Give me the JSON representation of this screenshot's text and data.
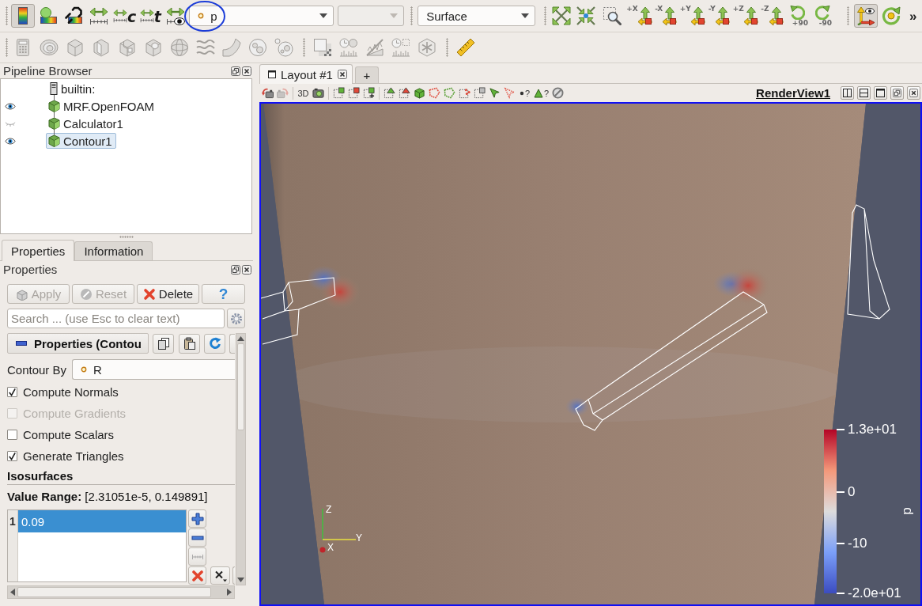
{
  "main_toolbar": {
    "color_buttons": [
      {
        "kind": "color-map",
        "on": true
      },
      {
        "kind": "sphere-bar",
        "on": false
      },
      {
        "kind": "unlink",
        "on": false
      },
      {
        "kind": "rescale",
        "on": false
      },
      {
        "kind": "rescale",
        "label": "c",
        "on": false
      },
      {
        "kind": "rescale",
        "label": "t",
        "on": false
      },
      {
        "kind": "rescale-visible",
        "on": false
      }
    ],
    "array_select": {
      "value": "p",
      "highlighted": true
    },
    "component_select": {
      "disabled": true
    },
    "representation_select": {
      "value": "Surface"
    },
    "camera_buttons": [
      {
        "kind": "reset"
      },
      {
        "kind": "zoom-data"
      },
      {
        "kind": "zoom-box"
      },
      {
        "kind": "axis",
        "label": "+X"
      },
      {
        "kind": "axis",
        "label": "-X"
      },
      {
        "kind": "axis",
        "label": "+Y"
      },
      {
        "kind": "axis",
        "label": "-Y"
      },
      {
        "kind": "axis",
        "label": "+Z"
      },
      {
        "kind": "axis",
        "label": "-Z"
      },
      {
        "kind": "rotate-cw",
        "label": "+90"
      },
      {
        "kind": "rotate-ccw",
        "label": "-90"
      }
    ],
    "view_buttons": [
      {
        "kind": "orientation-axes",
        "on": true
      },
      {
        "kind": "center-axes",
        "on": false
      }
    ],
    "overflow": "»"
  },
  "filters_toolbar": {
    "common": [
      {
        "kind": "calculator"
      },
      {
        "kind": "contour"
      },
      {
        "kind": "clip"
      },
      {
        "kind": "slice"
      },
      {
        "kind": "threshold"
      },
      {
        "kind": "subset"
      },
      {
        "kind": "glyph"
      },
      {
        "kind": "stream"
      },
      {
        "kind": "warp"
      },
      {
        "kind": "group"
      },
      {
        "kind": "level"
      }
    ],
    "analysis": [
      {
        "kind": "square-checker"
      },
      {
        "kind": "clock-bars"
      },
      {
        "kind": "plot-line"
      },
      {
        "kind": "clock-chart"
      },
      {
        "kind": "star-hex"
      }
    ],
    "measure": [
      {
        "kind": "ruler"
      }
    ]
  },
  "pipeline_browser": {
    "title": "Pipeline Browser",
    "server": "builtin:",
    "sources": [
      {
        "label": "MRF.OpenFOAM",
        "visible": true,
        "selected": false
      },
      {
        "label": "Calculator1",
        "visible": false,
        "selected": false
      },
      {
        "label": "Contour1",
        "visible": true,
        "selected": true
      }
    ]
  },
  "panel_tabs": [
    {
      "label": "Properties",
      "selected": true
    },
    {
      "label": "Information",
      "selected": false
    }
  ],
  "properties": {
    "title": "Properties",
    "buttons": [
      {
        "kind": "apply",
        "label": "Apply",
        "disabled": true
      },
      {
        "kind": "reset",
        "label": "Reset",
        "disabled": true
      },
      {
        "kind": "delete",
        "label": "Delete",
        "disabled": false
      },
      {
        "kind": "help",
        "label": "?",
        "disabled": false
      }
    ],
    "search": {
      "placeholder": "Search ... (use Esc to clear text)"
    },
    "section": {
      "title": "Properties (Contou",
      "expanded": true
    },
    "contour_by": {
      "label": "Contour By",
      "value": "R"
    },
    "options": [
      {
        "label": "Compute Normals",
        "checked": true,
        "disabled": false
      },
      {
        "label": "Compute Gradients",
        "checked": false,
        "disabled": true
      },
      {
        "label": "Compute Scalars",
        "checked": false,
        "disabled": false
      },
      {
        "label": "Generate Triangles",
        "checked": true,
        "disabled": false
      }
    ],
    "isosurfaces": {
      "title": "Isosurfaces",
      "value_range": "**Value Range:** [2.31051e-5, 0.149891]",
      "rows": [
        {
          "index": "1",
          "value": "0.09",
          "selected": true
        }
      ]
    }
  },
  "layout_tabs": [
    {
      "label": "Layout #1",
      "selected": true
    }
  ],
  "new_layout_tab": "+",
  "view_toolbar": {
    "groups": [
      {
        "buttons": [
          {
            "kind": "camera-undo",
            "disabled": false
          },
          {
            "kind": "camera-redo",
            "disabled": true
          }
        ]
      },
      {
        "buttons": [
          {
            "kind": "projection",
            "label": "3D",
            "disabled": false
          },
          {
            "kind": "capture",
            "disabled": false
          }
        ]
      },
      {
        "buttons": [
          {
            "kind": "sel-green",
            "disabled": false
          },
          {
            "kind": "sel-red",
            "disabled": false
          },
          {
            "kind": "sel-green-plus",
            "disabled": false
          }
        ]
      },
      {
        "buttons": [
          {
            "kind": "frustum-green",
            "disabled": false
          },
          {
            "kind": "frustum-red",
            "disabled": false
          },
          {
            "kind": "block",
            "disabled": false
          },
          {
            "kind": "poly-red",
            "disabled": false
          },
          {
            "kind": "poly-green",
            "disabled": false
          },
          {
            "kind": "sel-red-dots",
            "disabled": false
          },
          {
            "kind": "sel-grey",
            "disabled": false
          },
          {
            "kind": "cursor-green",
            "disabled": false
          },
          {
            "kind": "cursor-red",
            "disabled": false
          },
          {
            "kind": "hover-point",
            "label": "?",
            "disabled": false
          },
          {
            "kind": "hover-cell",
            "label": "?",
            "disabled": false
          },
          {
            "kind": "clear",
            "disabled": false
          }
        ]
      }
    ],
    "view_name": "RenderView1"
  },
  "render_view": {
    "active": true,
    "axes_labels": [
      "Z",
      "Y",
      "X"
    ],
    "color_legend": {
      "title": "p",
      "labels": [
        "1.3e+01",
        "0",
        "-10",
        "-2.0e+01"
      ]
    }
  }
}
